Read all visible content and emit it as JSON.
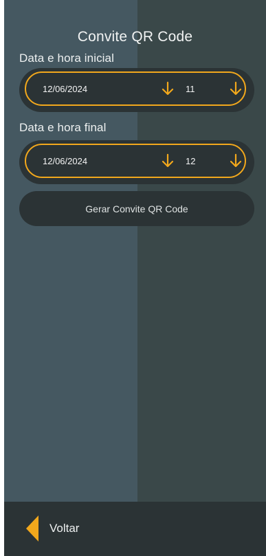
{
  "page": {
    "title": "Convite QR Code"
  },
  "start": {
    "label": "Data e hora inicial",
    "date": "12/06/2024",
    "hour": "11"
  },
  "end": {
    "label": "Data e hora final",
    "date": "12/06/2024",
    "hour": "12"
  },
  "actions": {
    "generate_label": "Gerar Convite QR Code",
    "back_label": "Voltar"
  },
  "icons": {
    "dropdown": "arrow-down-icon",
    "back": "chevron-left-icon"
  },
  "colors": {
    "accent": "#f2a81c",
    "panel_dark": "#2b3335",
    "bg_left": "#455861",
    "bg_right": "#3a4849",
    "text": "#eef1f1"
  }
}
